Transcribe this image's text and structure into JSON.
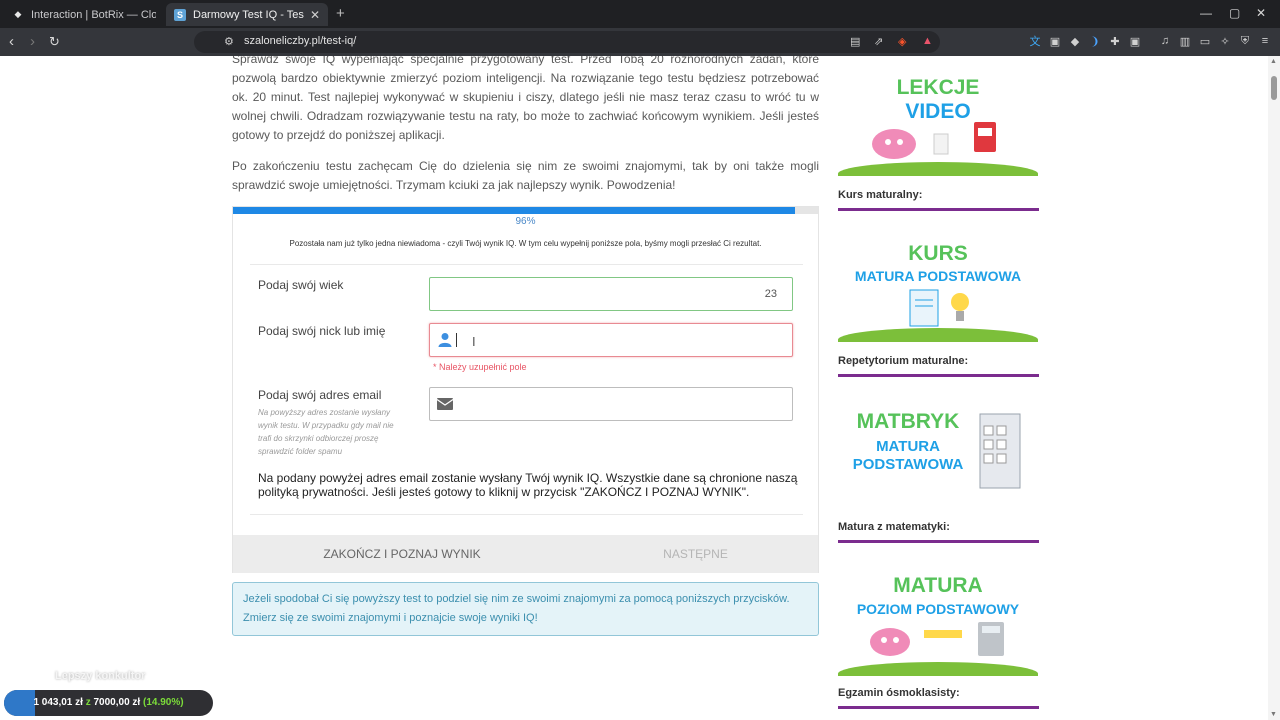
{
  "browser": {
    "tabs": [
      {
        "title": "Interaction | BotRix — Cloud Stream",
        "active": false
      },
      {
        "title": "Darmowy Test IQ - Testy",
        "active": true
      }
    ],
    "url": "szaloneliczby.pl/test-iq/"
  },
  "content": {
    "intro_paragraph": "Sprawdź swoje IQ wypełniając specjalnie przygotowany test. Przed Tobą 20 różnorodnych zadań, które pozwolą bardzo obiektywnie zmierzyć poziom inteligencji. Na rozwiązanie tego testu będziesz potrzebować ok. 20 minut. Test najlepiej wykonywać w skupieniu i ciszy, dlatego jeśli nie masz teraz czasu to wróć tu w wolnej chwili. Odradzam rozwiązywanie testu na raty, bo może to zachwiać końcowym wynikiem. Jeśli jesteś gotowy to przejdź do poniższej aplikacji.",
    "encourage_paragraph": "Po zakończeniu testu zachęcam Cię do dzielenia się nim ze swoimi znajomymi, tak by oni także mogli sprawdzić swoje umiejętności. Trzymam kciuki za jak najlepszy wynik. Powodzenia!"
  },
  "quiz": {
    "progress_percent": 96,
    "progress_label": "96%",
    "remaining_text": "Pozostała nam już tylko jedna niewiadoma - czyli Twój wynik IQ. W tym celu wypełnij poniższe pola, byśmy mogli przesłać Ci rezultat.",
    "age": {
      "label": "Podaj swój wiek",
      "value": "23"
    },
    "nick": {
      "label": "Podaj swój nick lub imię",
      "value": "",
      "error": "* Należy uzupełnić pole"
    },
    "email": {
      "label": "Podaj swój adres email",
      "hint": "Na powyższy adres zostanie wysłany wynik testu. W przypadku gdy mail nie trafi do skrzynki odbiorczej proszę sprawdzić folder spamu",
      "value": ""
    },
    "notice": "Na podany powyżej adres email zostanie wysłany Twój wynik IQ. Wszystkie dane są chronione naszą polityką prywatności. Jeśli jesteś gotowy to kliknij w przycisk \"ZAKOŃCZ I POZNAJ WYNIK\".",
    "finish_button": "ZAKOŃCZ I POZNAJ WYNIK",
    "next_button": "NASTĘPNE"
  },
  "share_info": "Jeżeli spodobał Ci się powyższy test to podziel się nim ze swoimi znajomymi za pomocą poniższych przycisków. Zmierz się ze swoimi znajomymi i poznajcie swoje wyniki IQ!",
  "sidebar": {
    "banner1": {
      "line1": "LEKCJE",
      "line2": "VIDEO"
    },
    "heading1": "Kurs maturalny:",
    "banner2": {
      "line1": "KURS",
      "line2": "MATURA PODSTAWOWA"
    },
    "heading2": "Repetytorium maturalne:",
    "banner3": {
      "line1": "MATBRYK",
      "line2": "MATURA",
      "line3": "PODSTAWOWA"
    },
    "heading3": "Matura z matematyki:",
    "banner4": {
      "line1": "MATURA",
      "line2": "POZIOM PODSTAWOWY"
    },
    "heading4": "Egzamin ósmoklasisty:"
  },
  "overlay": {
    "caption": "Lepszy konkultor",
    "current": "1 043,01 zł",
    "separator": "z",
    "goal": "7000,00 zł",
    "percent_label": "(14.90%)",
    "progress_fraction": 0.149
  },
  "colors": {
    "progress_blue": "#1e88e5",
    "banner_green": "#56c25a",
    "banner_blue": "#1ea0e6",
    "rule_purple": "#7b2c8e",
    "error_red": "#e85565"
  }
}
